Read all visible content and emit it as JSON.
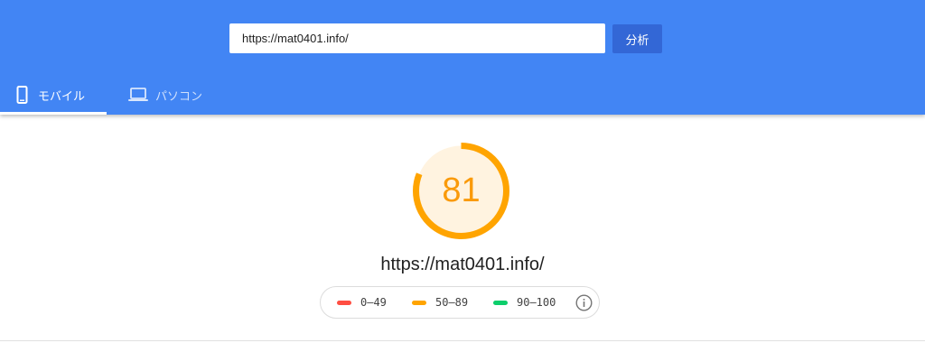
{
  "search": {
    "url_value": "https://mat0401.info/",
    "button_label": "分析"
  },
  "tabs": [
    {
      "label": "モバイル",
      "icon": "smartphone-icon",
      "active": true
    },
    {
      "label": "パソコン",
      "icon": "laptop-icon",
      "active": false
    }
  ],
  "report": {
    "score": "81",
    "score_fraction": 0.81,
    "url": "https://mat0401.info/"
  },
  "legend": [
    {
      "range": "0–49",
      "color": "#ff4e42"
    },
    {
      "range": "50–89",
      "color": "#ffa400"
    },
    {
      "range": "90–100",
      "color": "#0cce6b"
    }
  ],
  "colors": {
    "header": "#4285f4",
    "button": "#3367d6",
    "score_orange": "#fa9a0a",
    "gauge_fill": "#fff3e0"
  }
}
